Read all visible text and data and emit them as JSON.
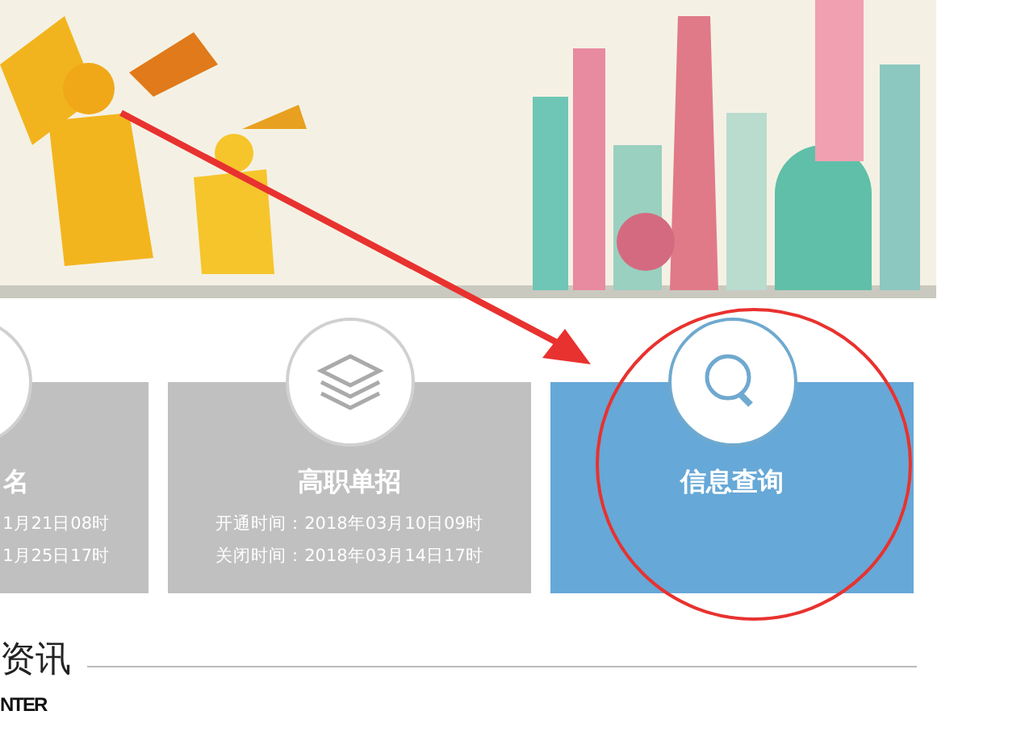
{
  "cards": [
    {
      "title": "名",
      "lines": [
        "1月21日08时",
        "1月25日17时"
      ],
      "selected": false
    },
    {
      "title": "高职单招",
      "lines": [
        "开通时间：2018年03月10日09时",
        "关闭时间：2018年03月14日17时"
      ],
      "selected": false
    },
    {
      "title": "信息查询",
      "selected": true
    }
  ],
  "section": {
    "title": "资讯",
    "subtitle": "NTER"
  }
}
